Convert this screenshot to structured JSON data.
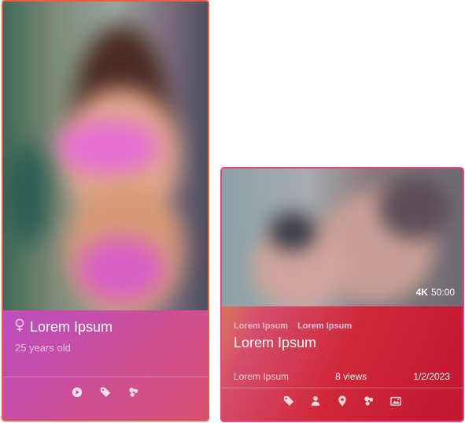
{
  "profile_card": {
    "gender_icon": "female-icon",
    "name": "Lorem Ipsum",
    "age": "25 years old",
    "action_icons": [
      "play-icon",
      "tag-icon",
      "fan-icon"
    ]
  },
  "video_card": {
    "quality": "4K",
    "duration": "50:00",
    "tags": [
      "Lorem Ipsum",
      "Lorem Ipsum"
    ],
    "title": "Lorem Ipsum",
    "author": "Lorem Ipsum",
    "views": "8 views",
    "date": "1/2/2023",
    "action_icons": [
      "tag-icon",
      "person-icon",
      "location-pin-icon",
      "fan-icon",
      "gallery-icon"
    ]
  }
}
